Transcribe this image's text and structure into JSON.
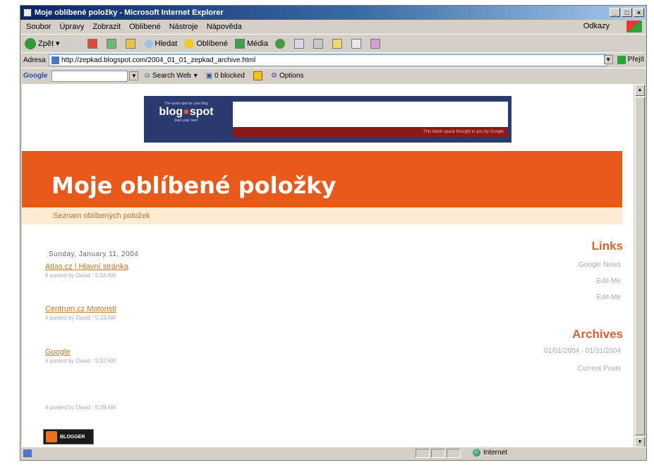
{
  "window": {
    "title": "Moje oblíbené položky - Microsoft Internet Explorer",
    "controls": [
      "_",
      "□",
      "×"
    ]
  },
  "menubar": {
    "items": [
      "Soubor",
      "Úpravy",
      "Zobrazit",
      "Oblíbené",
      "Nástroje",
      "Nápověda"
    ],
    "links_label": "Odkazy"
  },
  "toolbar": {
    "back": "Zpět",
    "search": "Hledat",
    "favorites": "Oblíbené",
    "media": "Média"
  },
  "address": {
    "label": "Adresa",
    "url": "http://zepkad.blogspot.com/2004_01_01_zepkad_archive.html",
    "go_label": "Přejít"
  },
  "googlebar": {
    "label": "Google",
    "search_web": "Search Web",
    "blocked_label": "0 blocked",
    "options_label": "Options"
  },
  "banner": {
    "logo_top": "The quick spot for your blog",
    "logo_word1": "blog",
    "logo_word2": "spot",
    "logo_bottom": "Start your own!",
    "strip_text": "This blank space brought to you by Google"
  },
  "blog": {
    "title": "Moje oblíbené položky",
    "description": "Seznam oblíbených položek"
  },
  "main": {
    "date_header": "Sunday, January 11, 2004",
    "posts": [
      {
        "title": "Atlas.cz | Hlavní stránka",
        "meta": "# posted by David : 5:34 AM"
      },
      {
        "title": "Centrum.cz Motoristi",
        "meta": "# posted by David : 5:33 AM"
      },
      {
        "title": "Google",
        "meta": "# posted by David : 5:32 AM"
      },
      {
        "title": "",
        "meta": "# posted by David : 5:29 AM"
      }
    ]
  },
  "sidebar": {
    "links_title": "Links",
    "links": [
      "Google News",
      "Edit-Me",
      "Edit-Me"
    ],
    "archives_title": "Archives",
    "archives": [
      "01/01/2004 - 01/31/2004",
      "Current Posts"
    ]
  },
  "badge": {
    "text": "BLOGGER"
  },
  "statusbar": {
    "zone": "Internet"
  },
  "colors": {
    "header_orange": "#e85a1c",
    "desc_bg": "#fdebd4",
    "sidebar_title": "#e06030",
    "link_color": "#c27a1a"
  }
}
